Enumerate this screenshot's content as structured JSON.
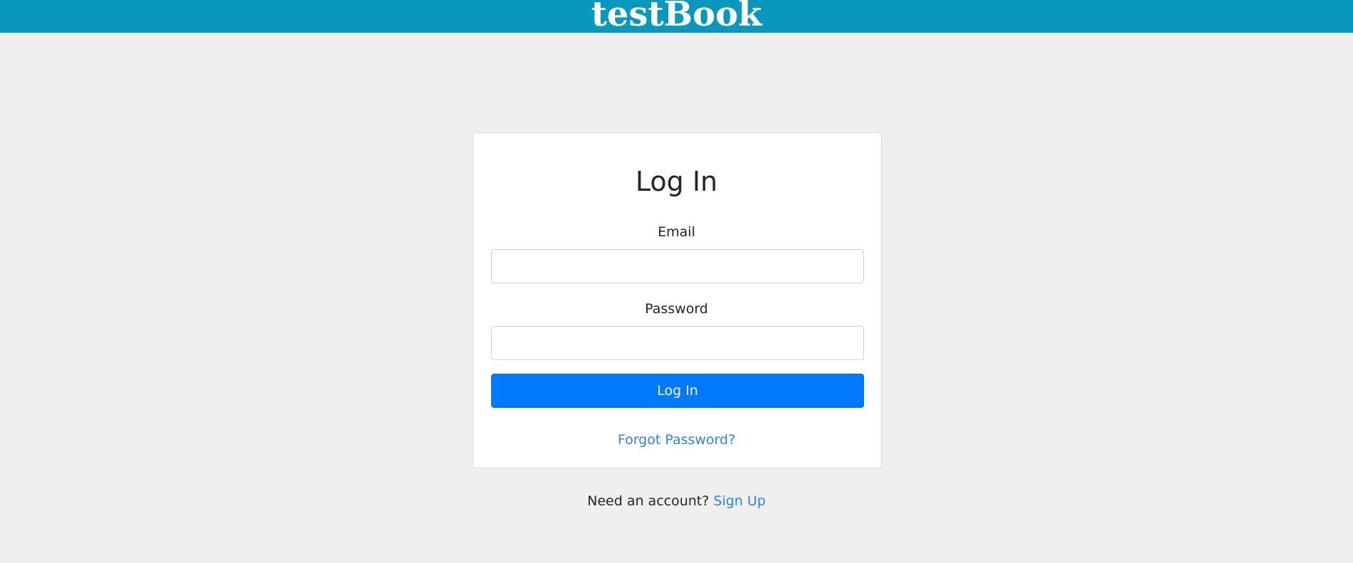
{
  "header": {
    "brand": "testBook",
    "background_color": "#0898bd"
  },
  "login_form": {
    "title": "Log In",
    "email_label": "Email",
    "email_value": "",
    "password_label": "Password",
    "password_value": "",
    "submit_label": "Log In",
    "submit_color": "#0079fd",
    "forgot_password_label": "Forgot Password?"
  },
  "footer": {
    "signup_prompt": "Need an account?",
    "signup_link": "Sign Up",
    "link_color": "#2f83da"
  }
}
